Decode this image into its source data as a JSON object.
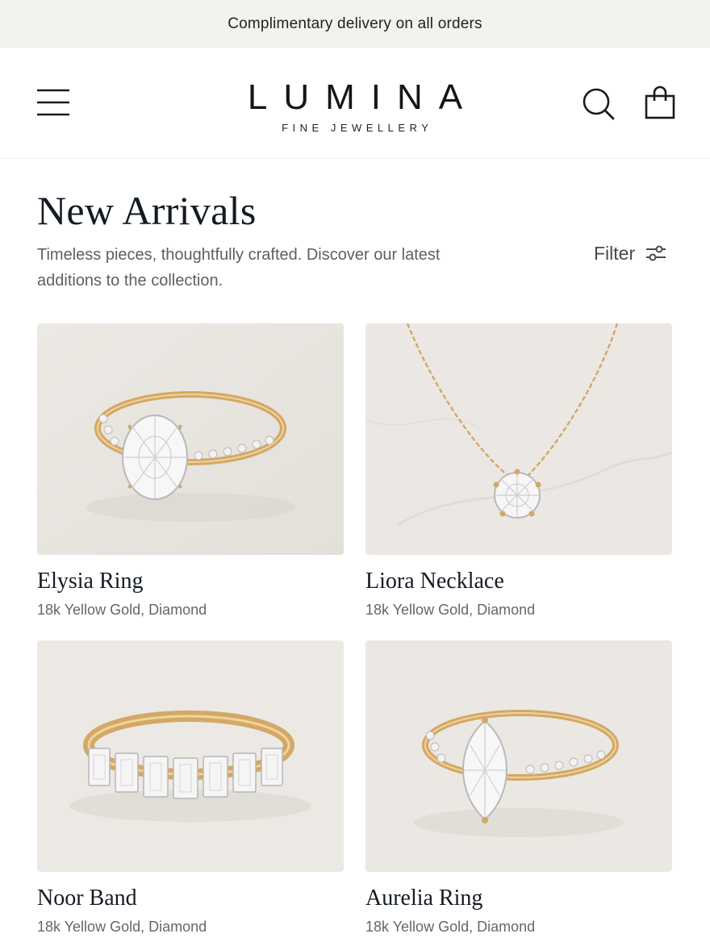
{
  "announcement": "Complimentary delivery on all orders",
  "brand": {
    "name": "LUMINA",
    "tagline": "FINE JEWELLERY"
  },
  "header_icons": [
    "menu-icon",
    "search-icon",
    "shopping-bag-icon"
  ],
  "page": {
    "title": "New Arrivals",
    "intro": "Timeless pieces, thoughtfully crafted. Discover our latest additions to the collection.",
    "filter_label": "Filter"
  },
  "products": [
    {
      "name": "Elysia Ring",
      "material": "18k Yellow Gold, Diamond"
    },
    {
      "name": "Liora Necklace",
      "material": "18k Yellow Gold, Diamond"
    },
    {
      "name": "Noor Band",
      "material": "18k Yellow Gold, Diamond"
    },
    {
      "name": "Aurelia Ring",
      "material": "18k Yellow Gold, Diamond"
    }
  ],
  "colors": {
    "announcement_bg": "#f4f2ef",
    "gold": "#d3a866",
    "text_dark": "#121a24",
    "text_muted": "#666666"
  }
}
